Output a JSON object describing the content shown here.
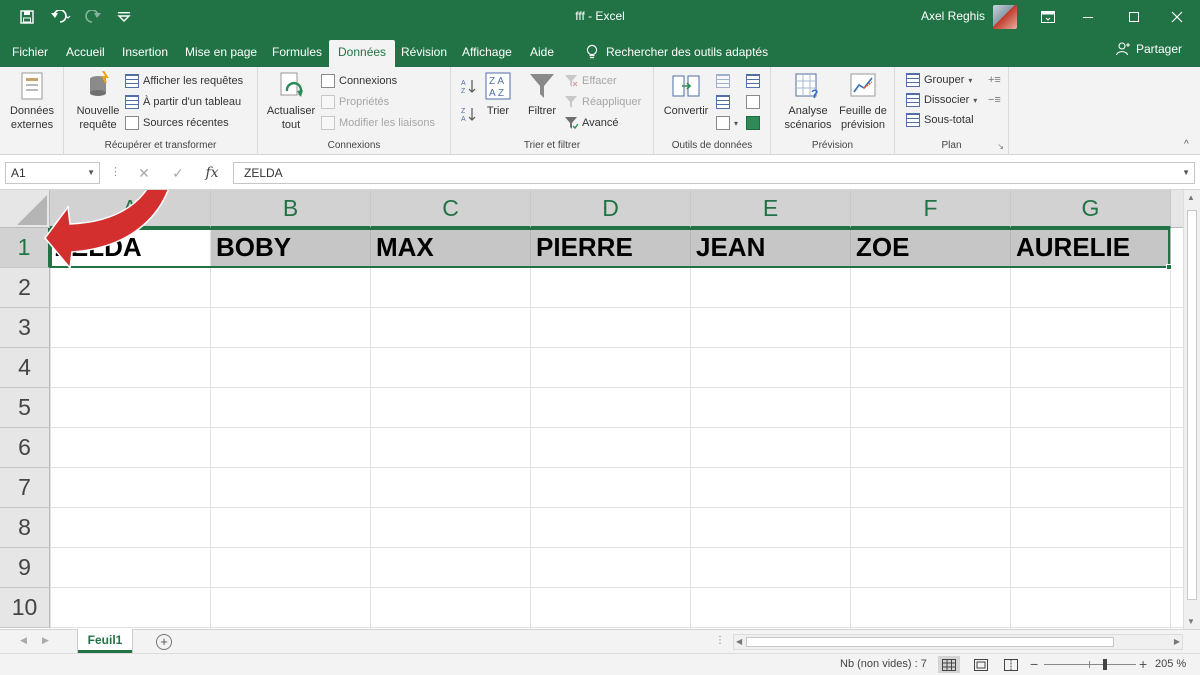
{
  "titlebar": {
    "title": "fff  -  Excel",
    "user": "Axel Reghis"
  },
  "tabs": [
    {
      "label": "Fichier"
    },
    {
      "label": "Accueil"
    },
    {
      "label": "Insertion"
    },
    {
      "label": "Mise en page"
    },
    {
      "label": "Formules"
    },
    {
      "label": "Données"
    },
    {
      "label": "Révision"
    },
    {
      "label": "Affichage"
    },
    {
      "label": "Aide"
    }
  ],
  "search_label": "Rechercher des outils adaptés",
  "share_label": "Partager",
  "ribbon": {
    "donnees_externes": [
      "Données",
      "externes"
    ],
    "recuperer": {
      "nouvelle_requete": [
        "Nouvelle",
        "requête"
      ],
      "afficher_requetes": "Afficher les requêtes",
      "a_partir_tableau": "À partir d'un tableau",
      "sources_recentes": "Sources récentes",
      "label": "Récupérer et transformer"
    },
    "connexions": {
      "actualiser": [
        "Actualiser",
        "tout"
      ],
      "connexions": "Connexions",
      "proprietes": "Propriétés",
      "modifier_liaisons": "Modifier les liaisons",
      "label": "Connexions"
    },
    "trier": {
      "trier": "Trier",
      "filtrer": "Filtrer",
      "effacer": "Effacer",
      "reappliquer": "Réappliquer",
      "avance": "Avancé",
      "label": "Trier et filtrer"
    },
    "outils": {
      "convertir": "Convertir",
      "label": "Outils de données"
    },
    "prevision": {
      "analyse": [
        "Analyse",
        "scénarios"
      ],
      "feuille": [
        "Feuille de",
        "prévision"
      ],
      "label": "Prévision"
    },
    "plan": {
      "grouper": "Grouper",
      "dissocier": "Dissocier",
      "sous_total": "Sous-total",
      "label": "Plan"
    }
  },
  "formula_bar": {
    "name_box": "A1",
    "value": "ZELDA"
  },
  "grid": {
    "columns": [
      "A",
      "B",
      "C",
      "D",
      "E",
      "F",
      "G"
    ],
    "rows": [
      "1",
      "2",
      "3",
      "4",
      "5",
      "6",
      "7",
      "8",
      "9",
      "10"
    ],
    "row1": [
      "ZELDA",
      "BOBY",
      "MAX",
      "PIERRE",
      "JEAN",
      "ZOE",
      "AURELIE"
    ]
  },
  "sheet_tab": "Feuil1",
  "status": {
    "count": "Nb (non vides) : 7",
    "zoom": "205 %"
  },
  "colors": {
    "accent": "#217346",
    "arrow": "#d32f2f"
  }
}
